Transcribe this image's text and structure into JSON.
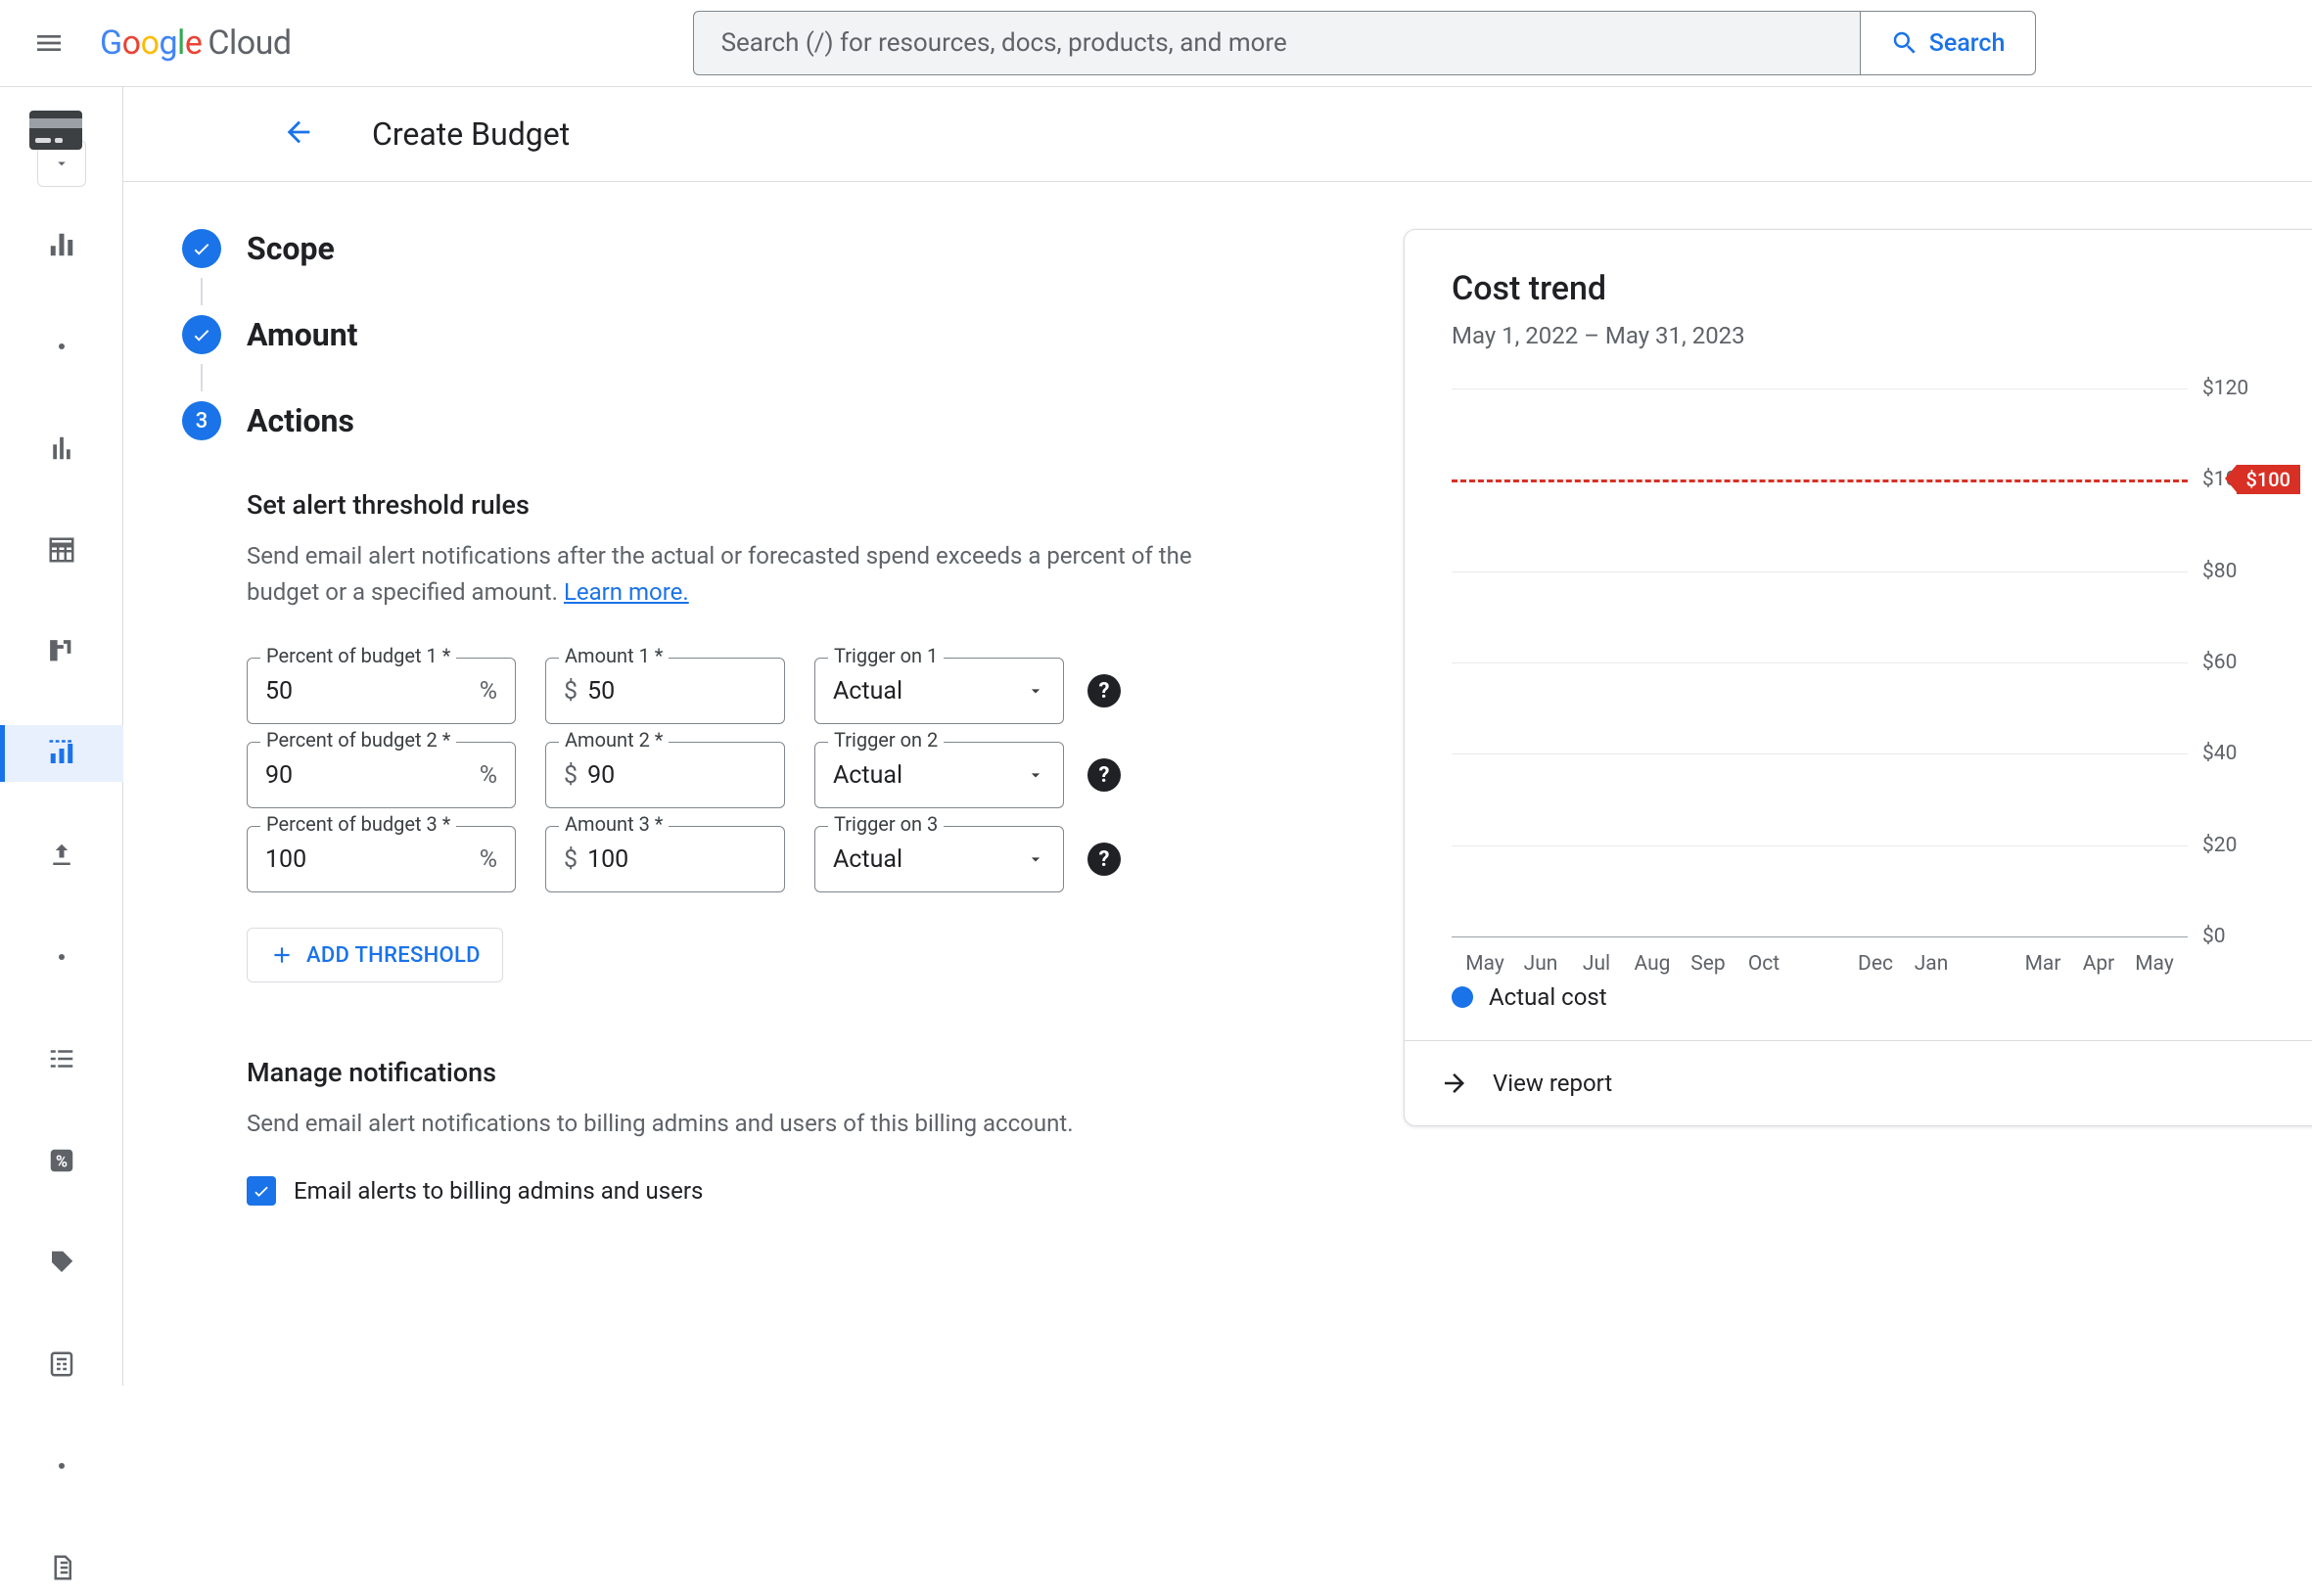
{
  "header": {
    "logo_cloud": "Cloud",
    "search_placeholder": "Search (/) for resources, docs, products, and more",
    "search_button": "Search"
  },
  "page": {
    "title": "Create Budget"
  },
  "stepper": {
    "step1": "Scope",
    "step2": "Amount",
    "step3_num": "3",
    "step3": "Actions"
  },
  "alerts": {
    "title": "Set alert threshold rules",
    "desc_pre": "Send email alert notifications after the actual or forecasted spend exceeds a percent of the budget or a specified amount. ",
    "learn_more": "Learn more.",
    "rows": [
      {
        "pct_label": "Percent of budget 1 *",
        "pct": "50",
        "amt_label": "Amount 1 *",
        "amt": "50",
        "trig_label": "Trigger on 1",
        "trig": "Actual"
      },
      {
        "pct_label": "Percent of budget 2 *",
        "pct": "90",
        "amt_label": "Amount 2 *",
        "amt": "90",
        "trig_label": "Trigger on 2",
        "trig": "Actual"
      },
      {
        "pct_label": "Percent of budget 3 *",
        "pct": "100",
        "amt_label": "Amount 3 *",
        "amt": "100",
        "trig_label": "Trigger on 3",
        "trig": "Actual"
      }
    ],
    "currency": "$",
    "percent": "%",
    "add_threshold": "ADD THRESHOLD"
  },
  "notify": {
    "title": "Manage notifications",
    "desc": "Send email alert notifications to billing admins and users of this billing account.",
    "check_label": "Email alerts to billing admins and users"
  },
  "cost_trend": {
    "title": "Cost trend",
    "subtitle": "May 1, 2022 – May 31, 2023",
    "legend": "Actual cost",
    "view_report": "View report"
  },
  "chart_data": {
    "type": "line",
    "title": "Cost trend",
    "xlabel": "",
    "ylabel": "",
    "ylim": [
      0,
      120
    ],
    "yticks": [
      0,
      20,
      40,
      60,
      80,
      100,
      120
    ],
    "ytick_labels": [
      "$0",
      "$20",
      "$40",
      "$60",
      "$80",
      "$100",
      "$120"
    ],
    "budget_amount": 100,
    "budget_label": "$100",
    "categories": [
      "May",
      "Jun",
      "Jul",
      "Aug",
      "Sep",
      "Oct",
      "",
      "Dec",
      "Jan",
      "",
      "Mar",
      "Apr",
      "May"
    ],
    "series": [
      {
        "name": "Actual cost",
        "values": [
          0,
          0,
          0,
          0,
          0,
          0,
          0,
          0,
          0,
          0,
          0,
          0,
          0
        ]
      }
    ]
  }
}
